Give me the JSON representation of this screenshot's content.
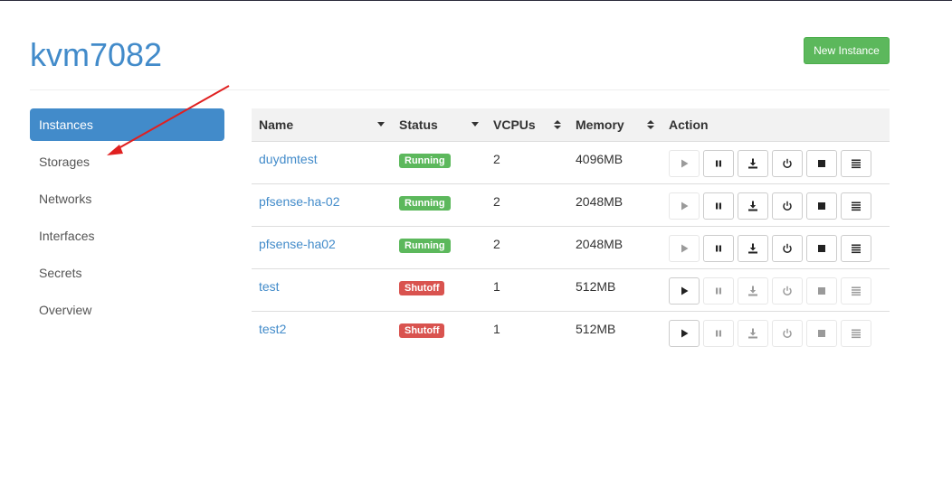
{
  "page": {
    "title": "kvm7082",
    "new_instance_label": "New Instance"
  },
  "sidebar": {
    "items": [
      {
        "label": "Instances",
        "active": true
      },
      {
        "label": "Storages",
        "active": false
      },
      {
        "label": "Networks",
        "active": false
      },
      {
        "label": "Interfaces",
        "active": false
      },
      {
        "label": "Secrets",
        "active": false
      },
      {
        "label": "Overview",
        "active": false
      }
    ]
  },
  "table": {
    "headers": {
      "name": "Name",
      "status": "Status",
      "vcpus": "VCPUs",
      "memory": "Memory",
      "action": "Action"
    },
    "rows": [
      {
        "name": "duydmtest",
        "status": "Running",
        "vcpus": "2",
        "memory": "4096MB"
      },
      {
        "name": "pfsense-ha-02",
        "status": "Running",
        "vcpus": "2",
        "memory": "2048MB"
      },
      {
        "name": "pfsense-ha02",
        "status": "Running",
        "vcpus": "2",
        "memory": "2048MB"
      },
      {
        "name": "test",
        "status": "Shutoff",
        "vcpus": "1",
        "memory": "512MB"
      },
      {
        "name": "test2",
        "status": "Shutoff",
        "vcpus": "1",
        "memory": "512MB"
      }
    ]
  },
  "colors": {
    "primary": "#428bca",
    "success": "#5cb85c",
    "danger": "#d9534f",
    "annotation_arrow": "#e02020"
  },
  "icons": [
    "play-icon",
    "pause-icon",
    "download-icon",
    "power-icon",
    "stop-icon",
    "menu-icon"
  ]
}
